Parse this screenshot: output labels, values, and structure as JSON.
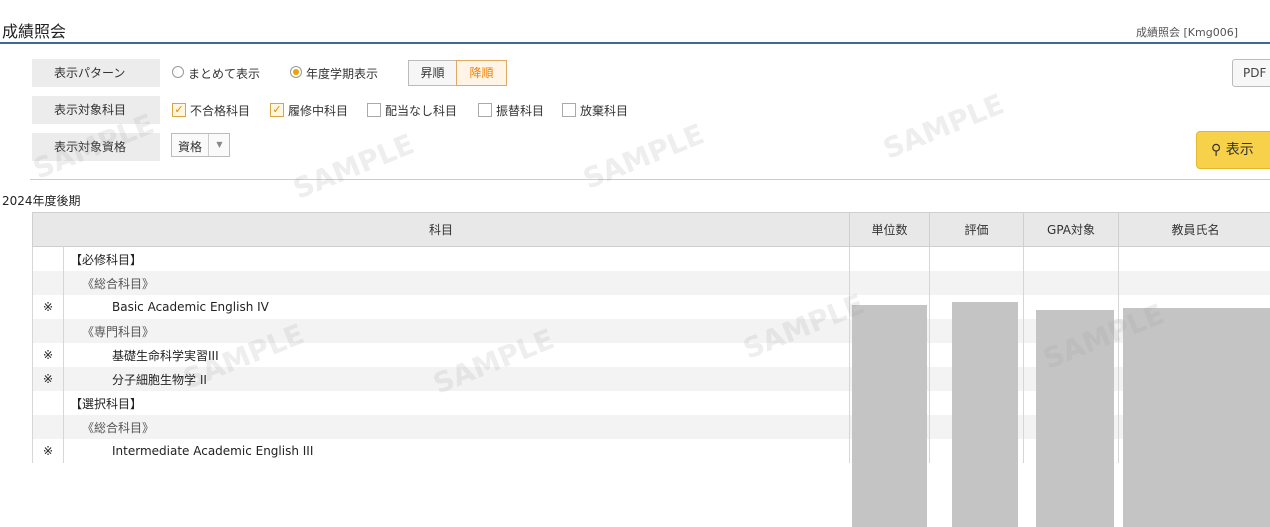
{
  "header": {
    "title": "成績照会",
    "screen_id": "成績照会 [Kmg006]"
  },
  "conditions": {
    "pattern": {
      "label": "表示パターン",
      "options": [
        {
          "label": "まとめて表示",
          "selected": false
        },
        {
          "label": "年度学期表示",
          "selected": true
        }
      ],
      "order": {
        "asc": "昇順",
        "desc": "降順",
        "selected": "降順"
      }
    },
    "subjects": {
      "label": "表示対象科目",
      "options": [
        {
          "label": "不合格科目",
          "checked": true
        },
        {
          "label": "履修中科目",
          "checked": true
        },
        {
          "label": "配当なし科目",
          "checked": false
        },
        {
          "label": "振替科目",
          "checked": false
        },
        {
          "label": "放棄科目",
          "checked": false
        }
      ]
    },
    "qualification": {
      "label": "表示対象資格",
      "value": "資格"
    }
  },
  "buttons": {
    "pdf": "PDF",
    "show": "表示"
  },
  "term": "2024年度後期",
  "table": {
    "columns": [
      "科目",
      "単位数",
      "評価",
      "GPA対象",
      "教員氏名"
    ],
    "rows": [
      {
        "mark": "",
        "level": 1,
        "name": "【必修科目】"
      },
      {
        "mark": "",
        "level": 2,
        "name": "《総合科目》"
      },
      {
        "mark": "※",
        "level": 3,
        "name": "Basic Academic English IV"
      },
      {
        "mark": "",
        "level": 2,
        "name": "《専門科目》"
      },
      {
        "mark": "※",
        "level": 3,
        "name": "基礎生命科学実習III"
      },
      {
        "mark": "※",
        "level": 3,
        "name": "分子細胞生物学 II"
      },
      {
        "mark": "",
        "level": 1,
        "name": "【選択科目】"
      },
      {
        "mark": "",
        "level": 2,
        "name": "《総合科目》"
      },
      {
        "mark": "※",
        "level": 3,
        "name": "Intermediate Academic English III"
      }
    ]
  },
  "watermark": "SAMPLE",
  "colors": {
    "accent_line": "#3d6a96",
    "show_button": "#f7d14a",
    "desc_order": "#f08000",
    "redacted": "#c4c4c4"
  }
}
